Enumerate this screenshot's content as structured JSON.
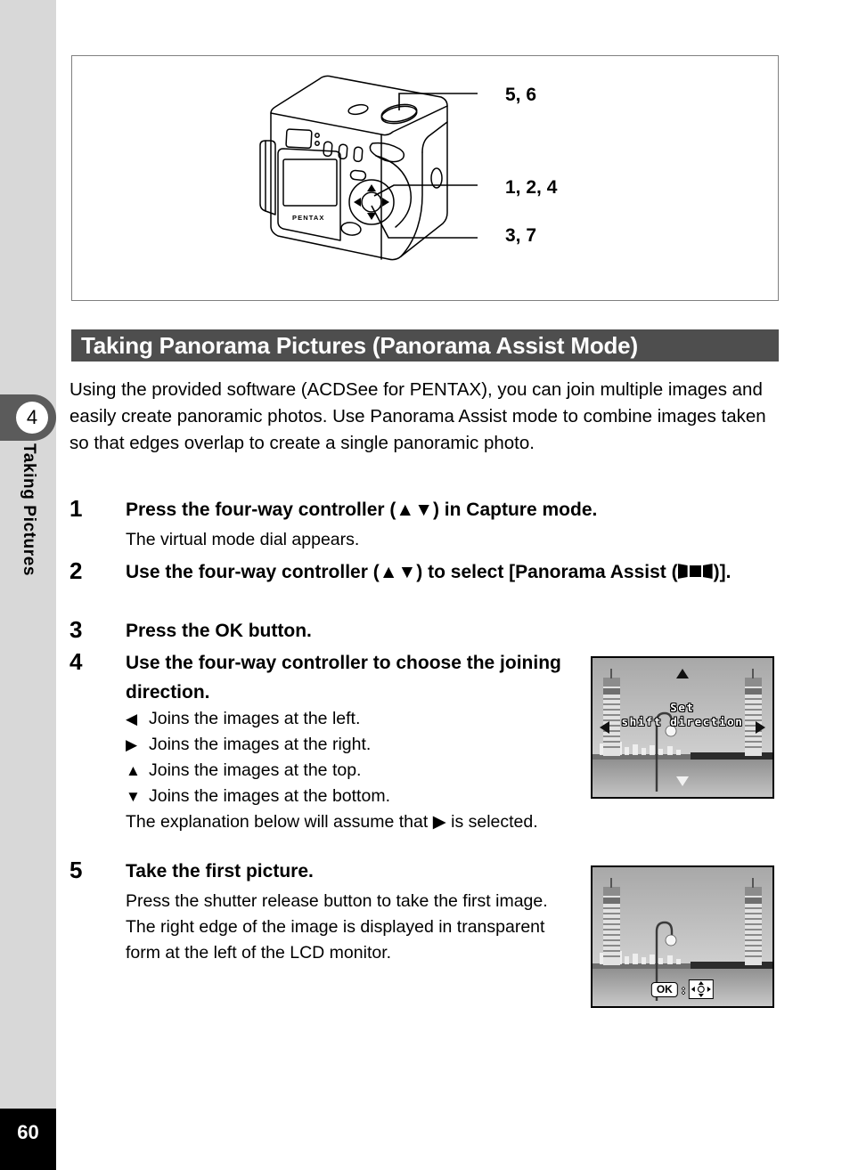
{
  "sidebar": {
    "chapter_number": "4",
    "chapter_title": "Taking Pictures"
  },
  "footer": {
    "page_number": "60"
  },
  "figure": {
    "camera_label": "PENTAX",
    "callouts": [
      {
        "id": "shutter-release",
        "label": "5, 6"
      },
      {
        "id": "four-way-controller",
        "label": "1, 2, 4"
      },
      {
        "id": "ok-button",
        "label": "3, 7"
      }
    ]
  },
  "heading": {
    "title": "Taking Panorama Pictures (Panorama Assist Mode)"
  },
  "intro": {
    "paragraph": "Using the provided software (ACDSee for PENTAX), you can join multiple images and easily create panoramic photos. Use Panorama Assist mode to combine images taken so that edges overlap to create a single panoramic photo."
  },
  "steps": [
    {
      "number": "1",
      "title_before": "Press the four-way controller (",
      "title_arrows": "▲▼",
      "title_after": ") in Capture mode.",
      "body": "The virtual mode dial appears."
    },
    {
      "number": "2",
      "title_before": "Use the four-way controller (",
      "title_arrows": "▲▼",
      "title_after": ") to select [Panorama Assist (",
      "title_tail": ")].",
      "body": ""
    },
    {
      "number": "3",
      "title": "Press the OK button.",
      "body": ""
    },
    {
      "number": "4",
      "title": "Use the four-way controller to choose the joining direction.",
      "bullets": [
        {
          "glyph": "◀",
          "text": "Joins the images at the left."
        },
        {
          "glyph": "▶",
          "text": "Joins the images at the right."
        },
        {
          "glyph": "▲",
          "text": "Joins the images at the top."
        },
        {
          "glyph": "▼",
          "text": "Joins the images at the bottom."
        }
      ],
      "note_before": "The explanation below will assume that ",
      "note_glyph": "▶",
      "note_after": " is selected."
    },
    {
      "number": "5",
      "title": "Take the first picture.",
      "body": "Press the shutter release button to take the first image. The right edge of the image is displayed in transparent form at the left of the LCD monitor."
    }
  ],
  "lcd_screens": [
    {
      "id": "set-shift-direction",
      "line1": "Set",
      "line2": "shift direction",
      "arrows": [
        "up",
        "down",
        "left",
        "right"
      ]
    },
    {
      "id": "first-picture-taken",
      "ok_label": "OK",
      "separator": ":"
    }
  ],
  "colors": {
    "sidebar_gray": "#d8d8d8",
    "chapter_tab": "#5b5b5b",
    "heading_bar": "#4e4e4e",
    "footer_black": "#000000",
    "figure_border": "#808080"
  }
}
